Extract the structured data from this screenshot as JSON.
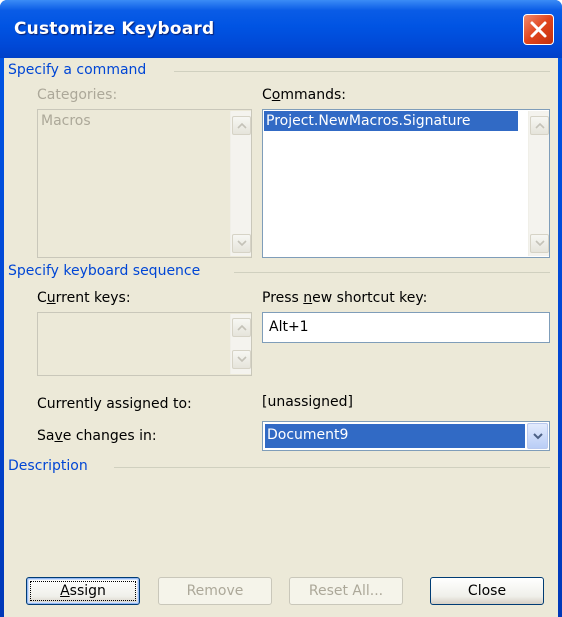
{
  "window": {
    "title": "Customize Keyboard"
  },
  "command_group": {
    "title": "Specify a command",
    "categories_label": "Categories:",
    "categories_items": [
      "Macros"
    ],
    "commands_label_pre": "C",
    "commands_label_u": "o",
    "commands_label_post": "mmands:",
    "commands_items": [
      "Project.NewMacros.Signature"
    ]
  },
  "keyboard_group": {
    "title": "Specify keyboard sequence",
    "current_keys_label_pre": "C",
    "current_keys_label_u": "u",
    "current_keys_label_post": "rrent keys:",
    "press_new_label_pre": "Press ",
    "press_new_label_u": "n",
    "press_new_label_post": "ew shortcut key:",
    "press_new_value": "Alt+1",
    "currently_assigned_label": "Currently assigned to:",
    "currently_assigned_value": "[unassigned]",
    "save_changes_label_pre": "Sa",
    "save_changes_label_u": "v",
    "save_changes_label_post": "e changes in:",
    "save_changes_value": "Document9"
  },
  "description_group": {
    "title": "Description"
  },
  "buttons": {
    "assign_u": "A",
    "assign_post": "ssign",
    "remove": "Remove",
    "reset_all": "Reset All...",
    "close": "Close"
  },
  "colors": {
    "titlebar": "#0054e3",
    "dialog_face": "#ece9d8",
    "selection": "#316ac5",
    "group_title": "#0046d5",
    "close_button": "#e0441c"
  },
  "icons": [
    "close-x-icon",
    "scroll-up-arrow-icon",
    "scroll-down-arrow-icon",
    "dropdown-arrow-icon"
  ]
}
